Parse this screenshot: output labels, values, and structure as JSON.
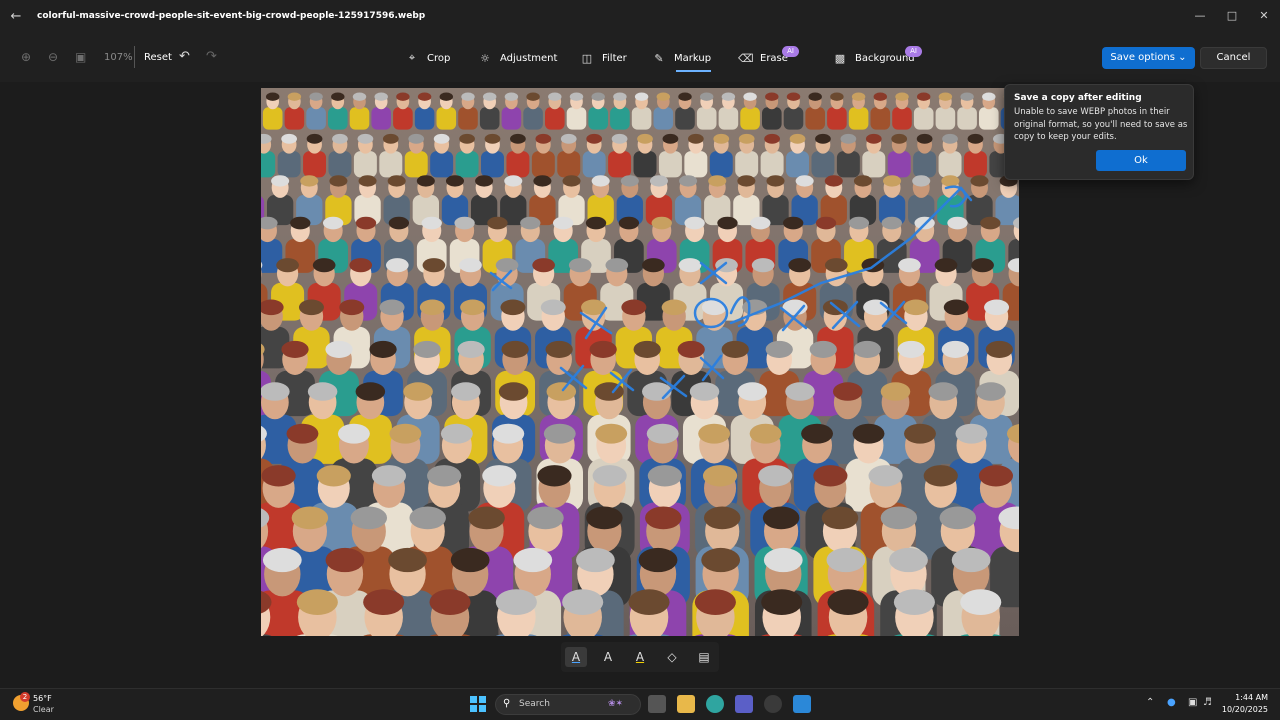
{
  "titlebar": {
    "file_name": "colorful-massive-crowd-people-sit-event-big-crowd-people-125917596.webp",
    "back_icon": "back-arrow-icon",
    "controls": [
      "minimize-icon",
      "maximize-icon",
      "close-icon"
    ]
  },
  "toolbar": {
    "zoom": "107%",
    "reset": "Reset",
    "tools": [
      {
        "label": "Crop",
        "icon": "crop-icon"
      },
      {
        "label": "Adjustment",
        "icon": "brightness-icon"
      },
      {
        "label": "Filter",
        "icon": "filter-icon"
      },
      {
        "label": "Markup",
        "icon": "pen-icon",
        "active": true
      },
      {
        "label": "Erase",
        "icon": "eraser-icon",
        "badge": "AI"
      },
      {
        "label": "Background",
        "icon": "background-icon",
        "badge": "AI"
      }
    ],
    "save": "Save options",
    "cancel": "Cancel"
  },
  "popup": {
    "title": "Save a copy after editing",
    "body": "Unable to save WEBP photos in their original format, so you'll need to save as copy to keep your edits.",
    "ok": "Ok"
  },
  "photo": {
    "description_icon": "crowd-photo",
    "markup_color": "#2a7fe0"
  },
  "markup_tools": [
    "ballpoint-pen-icon",
    "pen-icon",
    "highlighter-icon",
    "eraser-icon",
    "clear-icon"
  ],
  "taskbar": {
    "temp": "56°F",
    "condition": "Clear",
    "weather_badge": "2",
    "search": "Search",
    "time": "1:44 AM",
    "date": "10/20/2025"
  },
  "colors": {
    "accent": "#0f6ed0",
    "ai_badge": "#a97be6",
    "background": "#1c1c1c"
  }
}
